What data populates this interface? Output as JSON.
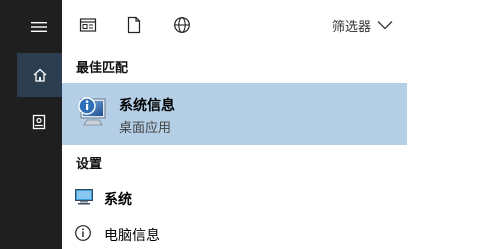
{
  "rail": {
    "items": [
      {
        "icon": "hamburger-menu-icon"
      },
      {
        "icon": "home-icon",
        "active": true
      },
      {
        "icon": "notebook-icon"
      }
    ]
  },
  "toolbar": {
    "icons": [
      "documents-filter-icon",
      "file-filter-icon",
      "web-filter-icon"
    ],
    "filter_label": "筛选器"
  },
  "best_match": {
    "heading": "最佳匹配",
    "title": "系统信息",
    "subtitle": "桌面应用"
  },
  "settings": {
    "heading": "设置",
    "items": [
      {
        "label": "系统",
        "icon": "monitor-icon"
      },
      {
        "label": "电脑信息",
        "icon": "info-icon"
      }
    ]
  },
  "colors": {
    "rail_bg": "#1f1f1f",
    "rail_active": "#2c3e50",
    "highlight": "#b4cfe6"
  }
}
